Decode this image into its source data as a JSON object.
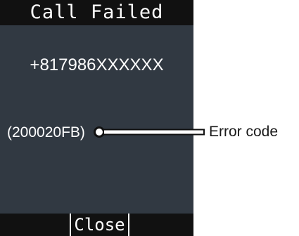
{
  "screen": {
    "title": "Call Failed",
    "phone_number": "+817986XXXXXX",
    "error_code": "(200020FB)"
  },
  "softkeys": {
    "center_label": "Close"
  },
  "callout": {
    "label": "Error code"
  },
  "colors": {
    "screen_background": "#313942",
    "bar_background": "#111111",
    "screen_text": "#ffffff",
    "callout_text": "#1a1a1a"
  }
}
